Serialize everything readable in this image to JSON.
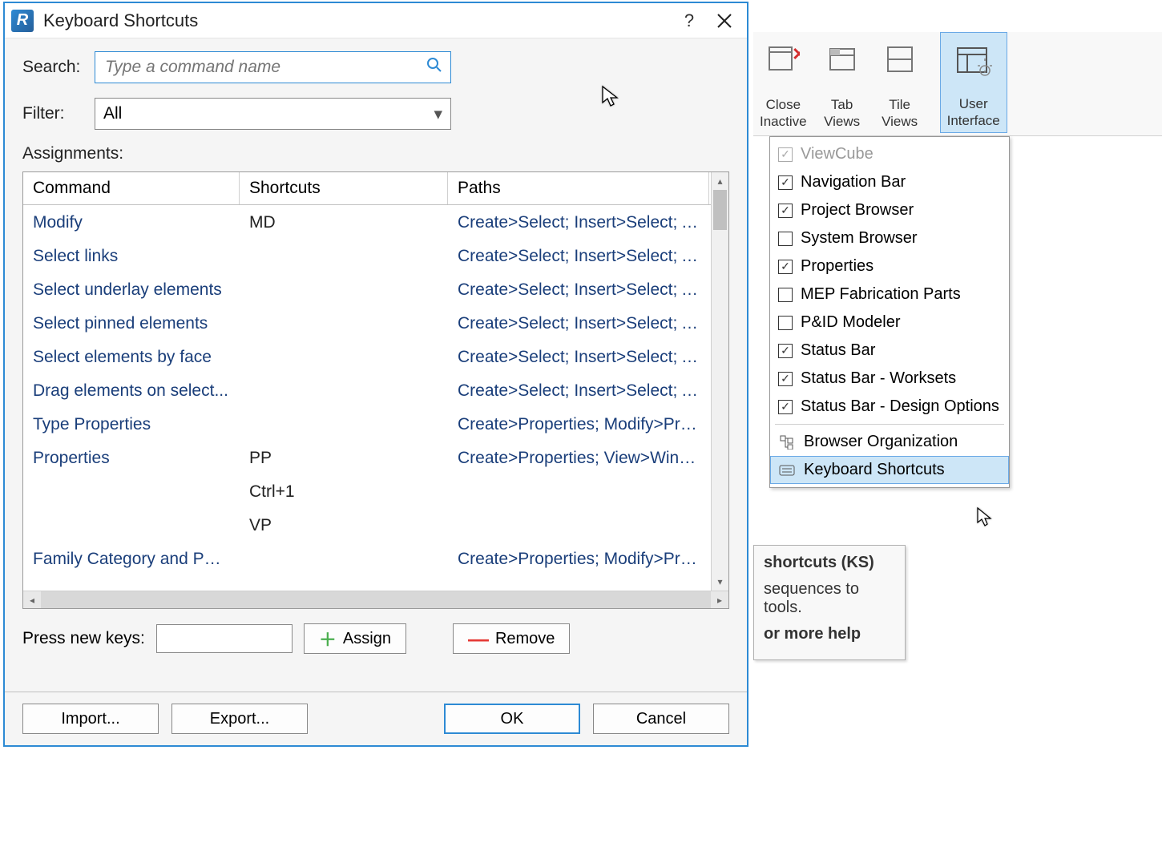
{
  "dialog": {
    "title": "Keyboard Shortcuts",
    "search_label": "Search:",
    "search_placeholder": "Type a command name",
    "filter_label": "Filter:",
    "filter_value": "All",
    "assignments_label": "Assignments:",
    "columns": {
      "command": "Command",
      "shortcuts": "Shortcuts",
      "paths": "Paths"
    },
    "rows": [
      {
        "command": "Modify",
        "shortcut": "MD",
        "path": "Create>Select; Insert>Select; Ann..."
      },
      {
        "command": "Select links",
        "shortcut": "",
        "path": "Create>Select; Insert>Select; Ann..."
      },
      {
        "command": "Select underlay elements",
        "shortcut": "",
        "path": "Create>Select; Insert>Select; Ann..."
      },
      {
        "command": "Select pinned elements",
        "shortcut": "",
        "path": "Create>Select; Insert>Select; Ann..."
      },
      {
        "command": "Select elements by face",
        "shortcut": "",
        "path": "Create>Select; Insert>Select; Ann..."
      },
      {
        "command": "Drag elements on select...",
        "shortcut": "",
        "path": "Create>Select; Insert>Select; Ann..."
      },
      {
        "command": "Type Properties",
        "shortcut": "",
        "path": "Create>Properties; Modify>Prope..."
      },
      {
        "command": "Properties",
        "shortcut": "PP",
        "path": "Create>Properties; View>Windo..."
      },
      {
        "command": "",
        "shortcut": "Ctrl+1",
        "path": ""
      },
      {
        "command": "",
        "shortcut": "VP",
        "path": ""
      },
      {
        "command": "Family Category and Par...",
        "shortcut": "",
        "path": "Create>Properties; Modify>Prope..."
      }
    ],
    "press_keys_label": "Press new keys:",
    "assign_label": "Assign",
    "remove_label": "Remove",
    "import_label": "Import...",
    "export_label": "Export...",
    "ok_label": "OK",
    "cancel_label": "Cancel"
  },
  "ribbon": {
    "close_inactive": "Close\nInactive",
    "tab_views": "Tab\nViews",
    "tile_views": "Tile\nViews",
    "user_interface": "User\nInterface"
  },
  "menu": {
    "items": [
      {
        "label": "ViewCube",
        "checked": true,
        "disabled": true,
        "type": "check"
      },
      {
        "label": "Navigation Bar",
        "checked": true,
        "type": "check"
      },
      {
        "label": "Project Browser",
        "checked": true,
        "type": "check"
      },
      {
        "label": "System Browser",
        "checked": false,
        "type": "check"
      },
      {
        "label": "Properties",
        "checked": true,
        "type": "check"
      },
      {
        "label": "MEP Fabrication Parts",
        "checked": false,
        "type": "check"
      },
      {
        "label": "P&ID Modeler",
        "checked": false,
        "type": "check"
      },
      {
        "label": "Status Bar",
        "checked": true,
        "type": "check"
      },
      {
        "label": "Status Bar - Worksets",
        "checked": true,
        "type": "check"
      },
      {
        "label": "Status Bar - Design Options",
        "checked": true,
        "type": "check"
      },
      {
        "label": "Browser Organization",
        "type": "cmd",
        "icon": "tree"
      },
      {
        "label": "Keyboard Shortcuts",
        "type": "cmd",
        "icon": "keyboard",
        "highlight": true
      }
    ]
  },
  "tooltip": {
    "line1": "shortcuts (KS)",
    "line2": "sequences to tools.",
    "line3": "or more help"
  }
}
